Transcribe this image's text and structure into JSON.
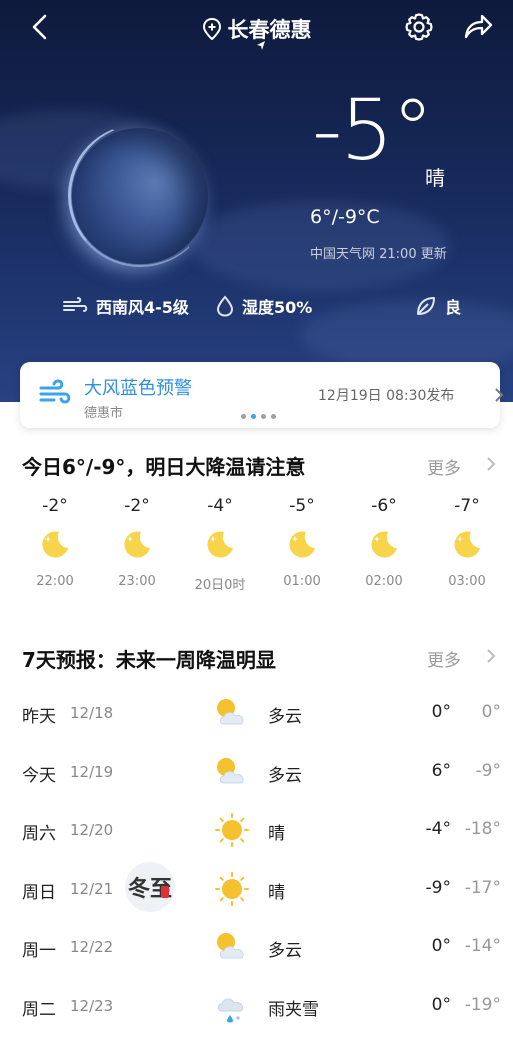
{
  "header": {
    "city": "长春德惠"
  },
  "current": {
    "temp": "-5°",
    "condition": "晴",
    "range": "6°/-9°C",
    "source": "中国天气网 21:00 更新",
    "wind": "西南风4-5级",
    "humidity": "湿度50%",
    "air": "良"
  },
  "alert": {
    "title": "大风蓝色预警",
    "location": "德惠市",
    "time": "12月19日 08:30发布"
  },
  "hourly_section": {
    "title": "今日6°/-9°，明日大降温请注意",
    "more": "更多",
    "hours": [
      {
        "temp": "-2°",
        "time": "22:00",
        "icon": "moon-icon"
      },
      {
        "temp": "-2°",
        "time": "23:00",
        "icon": "moon-icon"
      },
      {
        "temp": "-4°",
        "time": "20日0时",
        "icon": "moon-icon"
      },
      {
        "temp": "-5°",
        "time": "01:00",
        "icon": "moon-icon"
      },
      {
        "temp": "-6°",
        "time": "02:00",
        "icon": "moon-icon"
      },
      {
        "temp": "-7°",
        "time": "03:00",
        "icon": "moon-icon"
      }
    ]
  },
  "daily_section": {
    "title": "7天预报：未来一周降温明显",
    "more": "更多",
    "days": [
      {
        "name": "昨天",
        "date": "12/18",
        "icon": "partly-cloudy-icon",
        "cond": "多云",
        "high": "0°",
        "low": "0°"
      },
      {
        "name": "今天",
        "date": "12/19",
        "icon": "partly-cloudy-icon",
        "cond": "多云",
        "high": "6°",
        "low": "-9°"
      },
      {
        "name": "周六",
        "date": "12/20",
        "icon": "sun-icon",
        "cond": "晴",
        "high": "-4°",
        "low": "-18°"
      },
      {
        "name": "周日",
        "date": "12/21",
        "icon": "sun-icon",
        "cond": "晴",
        "high": "-9°",
        "low": "-17°"
      },
      {
        "name": "周一",
        "date": "12/22",
        "icon": "partly-cloudy-icon",
        "cond": "多云",
        "high": "0°",
        "low": "-14°"
      },
      {
        "name": "周二",
        "date": "12/23",
        "icon": "sleet-icon",
        "cond": "雨夹雪",
        "high": "0°",
        "low": "-19°"
      }
    ],
    "badge": "冬至"
  },
  "colors": {
    "accent": "#2f8fe0",
    "sun": "#f6c12e",
    "moon": "#f7d44a"
  }
}
